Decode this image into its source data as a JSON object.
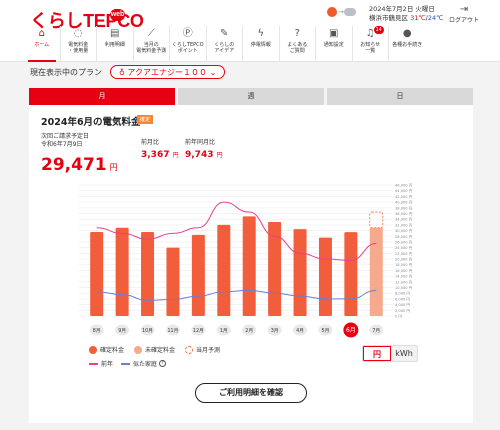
{
  "header": {
    "logo": "くらしTEPCO",
    "logo_badge": "web",
    "weather": {
      "sun_icon": "sun-icon",
      "cloud_icon": "cloud-icon",
      "date": "2024年7月2日 火曜日",
      "place": "横浜市鶴見区",
      "tmax": "31℃",
      "sep": "/",
      "tmin": "24℃"
    },
    "logout": "ログアウト"
  },
  "nav": [
    {
      "label": "ホーム",
      "icon": "home-icon",
      "glyph": "⌂",
      "active": true
    },
    {
      "label": "電気料金\n・使用量",
      "icon": "lightbulb-icon",
      "glyph": "◌"
    },
    {
      "label": "利用明細",
      "icon": "document-icon",
      "glyph": "▤"
    },
    {
      "label": "当月の\n電気料金予測",
      "icon": "chart-icon",
      "glyph": "⟋"
    },
    {
      "label": "くらしTEPCO\nポイント",
      "icon": "point-icon",
      "glyph": "Ⓟ"
    },
    {
      "label": "くらしの\nアイデア",
      "icon": "idea-icon",
      "glyph": "✎"
    },
    {
      "label": "停電情報",
      "icon": "lightning-icon",
      "glyph": "ϟ"
    },
    {
      "label": "よくある\nご質問",
      "icon": "question-icon",
      "glyph": "?"
    },
    {
      "label": "通知設定",
      "icon": "notification-settings-icon",
      "glyph": "▣"
    },
    {
      "label": "お知らせ\n一覧",
      "icon": "bell-icon",
      "glyph": "♫",
      "badge": "14"
    },
    {
      "label": "各種お手続き",
      "icon": "person-icon",
      "glyph": "●"
    }
  ],
  "plan": {
    "label": "現在表示中のプラン",
    "value": "アクアエナジー１００",
    "icon": "bulb-icon"
  },
  "tabs": [
    {
      "label": "月",
      "active": true
    },
    {
      "label": "週"
    },
    {
      "label": "日"
    }
  ],
  "summary": {
    "title": "2024年6月の電気料金",
    "badge": "確定",
    "next_label": "次回ご請求予定日",
    "next_date": "令和6年7月9日",
    "amount": "29,471",
    "amount_unit": "円",
    "prev_month_label": "前月比",
    "prev_month_value": "3,367",
    "prev_year_label": "前年同月比",
    "prev_year_value": "9,743",
    "yen": "円"
  },
  "chart_data": {
    "type": "bar",
    "categories": [
      "8月",
      "9月",
      "10月",
      "11月",
      "12月",
      "1月",
      "2月",
      "3月",
      "4月",
      "5月",
      "6月",
      "7月"
    ],
    "selected": "6月",
    "series": [
      {
        "name": "確定料金",
        "values": [
          29500,
          31000,
          29500,
          24000,
          28500,
          32000,
          35000,
          33000,
          30500,
          27500,
          29471,
          null
        ]
      },
      {
        "name": "未確定料金",
        "values": [
          null,
          null,
          null,
          null,
          null,
          null,
          null,
          null,
          null,
          null,
          null,
          31000
        ]
      },
      {
        "name": "前年",
        "type": "line",
        "values": [
          31000,
          29000,
          27000,
          29000,
          31000,
          40000,
          36500,
          28000,
          22000,
          20000,
          19500,
          25500
        ]
      },
      {
        "name": "似た家庭",
        "type": "line",
        "values": [
          8500,
          7500,
          5500,
          5800,
          7000,
          8500,
          9000,
          8000,
          7000,
          6000,
          6000,
          9000
        ]
      }
    ],
    "forecast": {
      "category": "7月",
      "value": 36500
    },
    "ylim": [
      0,
      46000
    ],
    "yticks": [
      "0 円",
      "2,000 円",
      "4,000 円",
      "6,000 円",
      "8,000 円",
      "10,000 円",
      "12,000 円",
      "14,000 円",
      "16,000 円",
      "18,000 円",
      "20,000 円",
      "22,000 円",
      "24,000 円",
      "26,000 円",
      "28,000 円",
      "30,000 円",
      "32,000 円",
      "34,000 円",
      "36,000 円",
      "38,000 円",
      "40,000 円",
      "42,000 円",
      "44,000 円",
      "46,000 円"
    ],
    "colors": {
      "bar": "#f25d3b",
      "bar_light": "#f7a98d",
      "forecast": "#f36b3b",
      "prev_year": "#e8428d",
      "similar": "#6b7fd1",
      "grid": "#ececec"
    }
  },
  "legend": {
    "confirmed": "確定料金",
    "unconfirmed": "未確定料金",
    "forecast": "当月予測",
    "prev_year": "前年",
    "similar": "似た家庭"
  },
  "unit_toggle": {
    "yen": "円",
    "kwh": "kWh"
  },
  "detail_button": "ご利用明細を確認"
}
